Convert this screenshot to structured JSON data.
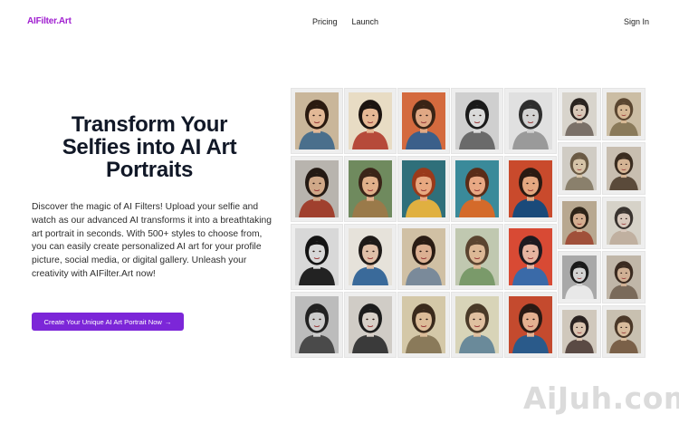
{
  "nav": {
    "logo": "AIFilter.Art",
    "links": [
      "Pricing",
      "Launch"
    ],
    "signin": "Sign In"
  },
  "hero": {
    "title": "Transform Your Selfies into AI Art Portraits",
    "description": "Discover the magic of AI Filters! Upload your selfie and watch as our advanced AI transforms it into a breathtaking art portrait in seconds. With 500+ styles to choose from, you can easily create personalized AI art for your profile picture, social media, or digital gallery. Unleash your creativity with AIFilter.Art now!",
    "cta_label": "Create Your Unique AI Art Portrait Now",
    "cta_arrow": "→"
  },
  "watermark": "AiJuh.com",
  "gallery": {
    "tiles": [
      {
        "bg": "#c9b69a",
        "hair": "#2a1a10",
        "skin": "#e2b896",
        "cloth": "#4a6f8c"
      },
      {
        "bg": "#e8dcc4",
        "hair": "#1c1410",
        "skin": "#e6b894",
        "cloth": "#b64a3a"
      },
      {
        "bg": "#d46a3e",
        "hair": "#3a2416",
        "skin": "#e0a884",
        "cloth": "#3b5f8a"
      },
      {
        "bg": "#cfcfcf",
        "hair": "#1a1a1a",
        "skin": "#dadada",
        "cloth": "#6a6a6a"
      },
      {
        "bg": "#e0e0e0",
        "hair": "#2e2e2e",
        "skin": "#d2d2d2",
        "cloth": "#9a9a9a"
      },
      {
        "bg": "#d8d4cc",
        "hair": "#2a2420",
        "skin": "#d8c8b8",
        "cloth": "#7a7068"
      },
      {
        "bg": "#cbbda4",
        "hair": "#5a4630",
        "skin": "#d6b894",
        "cloth": "#8a7a5a"
      },
      {
        "bg": "#b8b4ae",
        "hair": "#241a14",
        "skin": "#d0a888",
        "cloth": "#a0402e"
      },
      {
        "bg": "#6f8a5e",
        "hair": "#3a2418",
        "skin": "#e0b08a",
        "cloth": "#9a7a4a"
      },
      {
        "bg": "#2f6f7a",
        "hair": "#9a3a1a",
        "skin": "#e8a880",
        "cloth": "#e0b040"
      },
      {
        "bg": "#3a8a9a",
        "hair": "#5a2c18",
        "skin": "#e8a884",
        "cloth": "#d46a2a"
      },
      {
        "bg": "#c94a2c",
        "hair": "#2a1a12",
        "skin": "#e4a880",
        "cloth": "#1a4a7a"
      },
      {
        "bg": "#d0ccc4",
        "hair": "#6a5a44",
        "skin": "#d6c4a8",
        "cloth": "#8a806c"
      },
      {
        "bg": "#c8beb0",
        "hair": "#3a2c20",
        "skin": "#d4b494",
        "cloth": "#5a4a3a"
      },
      {
        "bg": "#d8d8d8",
        "hair": "#141414",
        "skin": "#d8d8d8",
        "cloth": "#222222"
      },
      {
        "bg": "#e6e2da",
        "hair": "#1e1a18",
        "skin": "#e0c0a8",
        "cloth": "#3a6a9a"
      },
      {
        "bg": "#d0c0a4",
        "hair": "#2a1c14",
        "skin": "#dcb092",
        "cloth": "#7a8a9a"
      },
      {
        "bg": "#c0c8b0",
        "hair": "#5a4430",
        "skin": "#dcb896",
        "cloth": "#7a9a6a"
      },
      {
        "bg": "#d84a34",
        "hair": "#1e1a20",
        "skin": "#e6b4a0",
        "cloth": "#3a6aa8"
      },
      {
        "bg": "#b8a890",
        "hair": "#2e2418",
        "skin": "#d4ae90",
        "cloth": "#a0503a"
      },
      {
        "bg": "#d6d2c8",
        "hair": "#3a3430",
        "skin": "#d8c8bc",
        "cloth": "#c0b0a0"
      },
      {
        "bg": "#bcbcbc",
        "hair": "#222222",
        "skin": "#cccccc",
        "cloth": "#4a4a4a"
      },
      {
        "bg": "#d0ccc6",
        "hair": "#1c1c1c",
        "skin": "#d8d0c8",
        "cloth": "#3a3a3a"
      },
      {
        "bg": "#d4c8a8",
        "hair": "#3a2a1c",
        "skin": "#dcbc98",
        "cloth": "#8a7a5a"
      },
      {
        "bg": "#d8d4b8",
        "hair": "#4a3a28",
        "skin": "#e0c0a0",
        "cloth": "#6a8a9a"
      },
      {
        "bg": "#c44a2e",
        "hair": "#2a1a14",
        "skin": "#e4b090",
        "cloth": "#2a5a8a"
      },
      {
        "bg": "#a8a8a8",
        "hair": "#1a1a1a",
        "skin": "#d4d4d4",
        "cloth": "#e8e8e8"
      },
      {
        "bg": "#c0b6a8",
        "hair": "#3a2a20",
        "skin": "#d0b094",
        "cloth": "#7a6a5a"
      },
      {
        "bg": "#d0c8bc",
        "hair": "#2a2220",
        "skin": "#dac4b0",
        "cloth": "#5a4a44"
      },
      {
        "bg": "#c8c0b0",
        "hair": "#4a3828",
        "skin": "#d8bc9c",
        "cloth": "#7a6048"
      },
      {
        "bg": "#d8d8d8",
        "hair": "#222222",
        "skin": "#d8d8d8",
        "cloth": "#7a7a7a"
      },
      {
        "bg": "#cfcbc4",
        "hair": "#2c2420",
        "skin": "#d6c6b8",
        "cloth": "#3a3430"
      },
      {
        "bg": "#c8beae",
        "hair": "#2a2018",
        "skin": "#d6b8a0",
        "cloth": "#8a4a3a"
      },
      {
        "bg": "#d0ccc4",
        "hair": "#3a302a",
        "skin": "#d8c4b4",
        "cloth": "#6a5a50"
      }
    ]
  }
}
